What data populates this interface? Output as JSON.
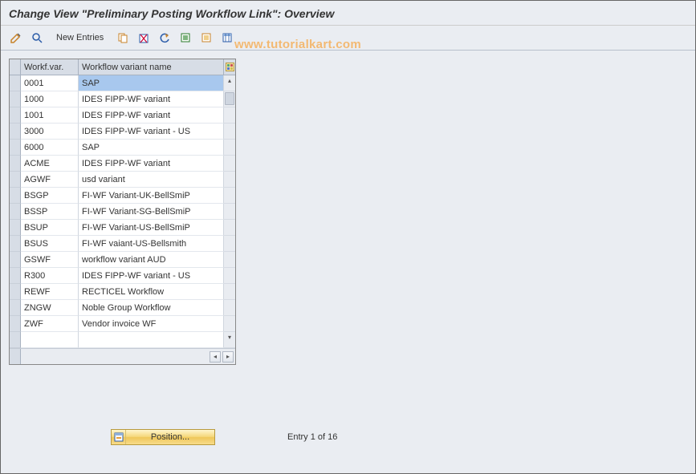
{
  "title": "Change View \"Preliminary Posting Workflow Link\": Overview",
  "watermark": "www.tutorialkart.com",
  "toolbar": {
    "new_entries_label": "New Entries"
  },
  "table": {
    "columns": {
      "code": "Workf.var.",
      "name": "Workflow variant name"
    },
    "rows": [
      {
        "code": "0001",
        "name": "SAP",
        "selected": true
      },
      {
        "code": "1000",
        "name": "IDES FIPP-WF variant"
      },
      {
        "code": "1001",
        "name": "IDES FIPP-WF variant"
      },
      {
        "code": "3000",
        "name": "IDES FIPP-WF variant - US"
      },
      {
        "code": "6000",
        "name": "SAP"
      },
      {
        "code": "ACME",
        "name": "IDES FIPP-WF variant"
      },
      {
        "code": "AGWF",
        "name": "usd variant"
      },
      {
        "code": "BSGP",
        "name": "FI-WF Variant-UK-BellSmiP"
      },
      {
        "code": "BSSP",
        "name": "FI-WF Variant-SG-BellSmiP"
      },
      {
        "code": "BSUP",
        "name": "FI-WF Variant-US-BellSmiP"
      },
      {
        "code": "BSUS",
        "name": "FI-WF vaiant-US-Bellsmith"
      },
      {
        "code": "GSWF",
        "name": "workflow variant AUD"
      },
      {
        "code": "R300",
        "name": "IDES FIPP-WF variant - US"
      },
      {
        "code": "REWF",
        "name": "RECTICEL Workflow"
      },
      {
        "code": "ZNGW",
        "name": "Noble Group Workflow"
      },
      {
        "code": "ZWF",
        "name": "Vendor invoice WF"
      },
      {
        "code": "",
        "name": ""
      }
    ]
  },
  "position_button": "Position...",
  "entry_counter": "Entry 1 of 16"
}
